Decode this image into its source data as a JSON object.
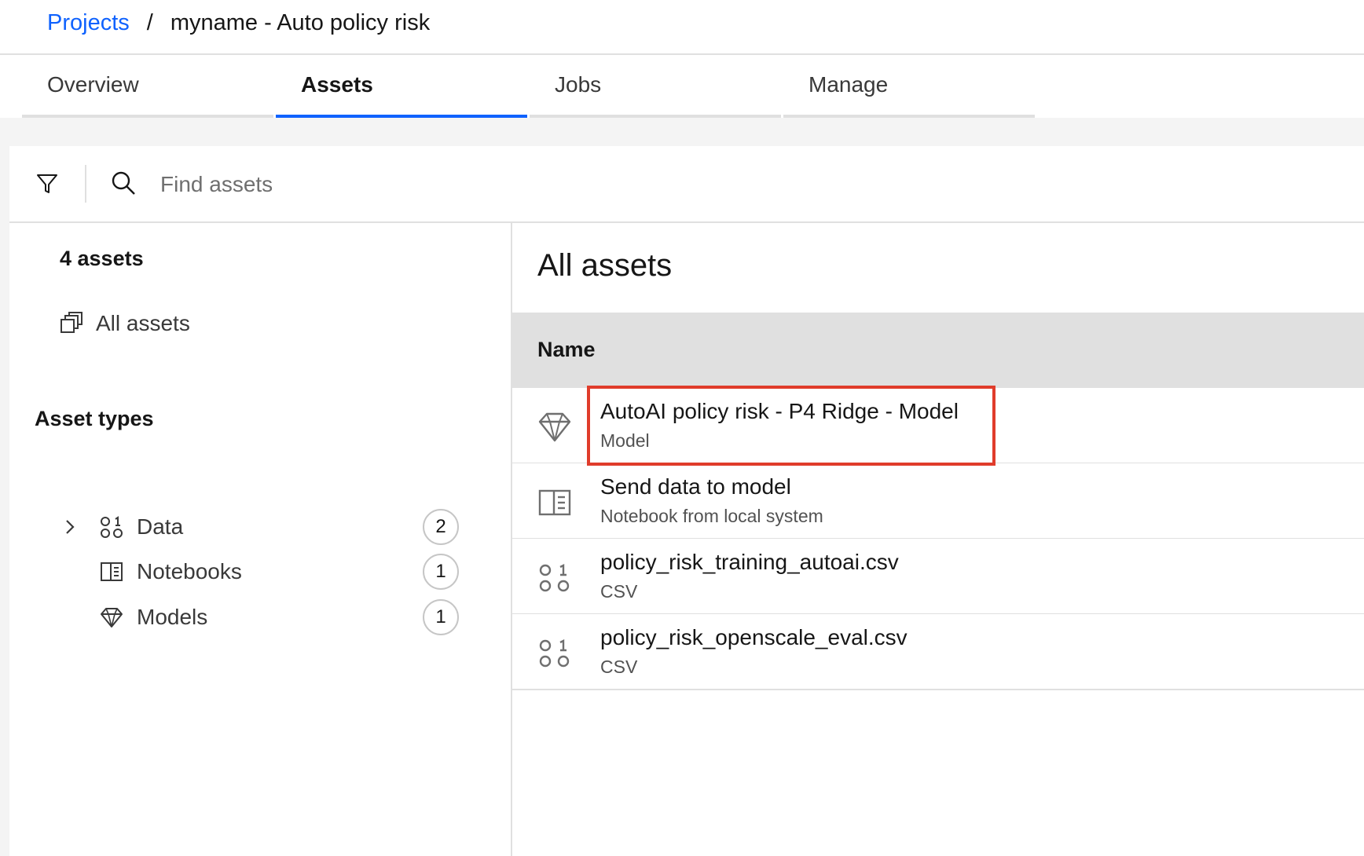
{
  "breadcrumb": {
    "parent": "Projects",
    "separator": "/",
    "current": "myname - Auto policy risk"
  },
  "tabs": [
    {
      "label": "Overview",
      "active": false
    },
    {
      "label": "Assets",
      "active": true
    },
    {
      "label": "Jobs",
      "active": false
    },
    {
      "label": "Manage",
      "active": false
    }
  ],
  "toolbar": {
    "search_placeholder": "Find assets",
    "filter_icon": "filter-icon",
    "search_icon": "search-icon"
  },
  "sidebar": {
    "count_label": "4 assets",
    "all_assets_label": "All assets",
    "asset_types_heading": "Asset types",
    "types": [
      {
        "label": "Data",
        "count": "2",
        "icon": "data-icon",
        "expandable": true
      },
      {
        "label": "Notebooks",
        "count": "1",
        "icon": "notebook-icon",
        "expandable": false
      },
      {
        "label": "Models",
        "count": "1",
        "icon": "model-icon",
        "expandable": false
      }
    ]
  },
  "main": {
    "title": "All assets",
    "column_name": "Name",
    "rows": [
      {
        "title": "AutoAI policy risk - P4 Ridge - Model",
        "subtitle": "Model",
        "icon": "model-icon",
        "highlighted": true
      },
      {
        "title": "Send data to model",
        "subtitle": "Notebook from local system",
        "icon": "notebook-icon",
        "highlighted": false
      },
      {
        "title": "policy_risk_training_autoai.csv",
        "subtitle": "CSV",
        "icon": "data-icon",
        "highlighted": false
      },
      {
        "title": "policy_risk_openscale_eval.csv",
        "subtitle": "CSV",
        "icon": "data-icon",
        "highlighted": false
      }
    ]
  },
  "colors": {
    "accent": "#0f62fe",
    "highlight_border": "#e03c2b",
    "header_bg": "#e0e0e0"
  }
}
